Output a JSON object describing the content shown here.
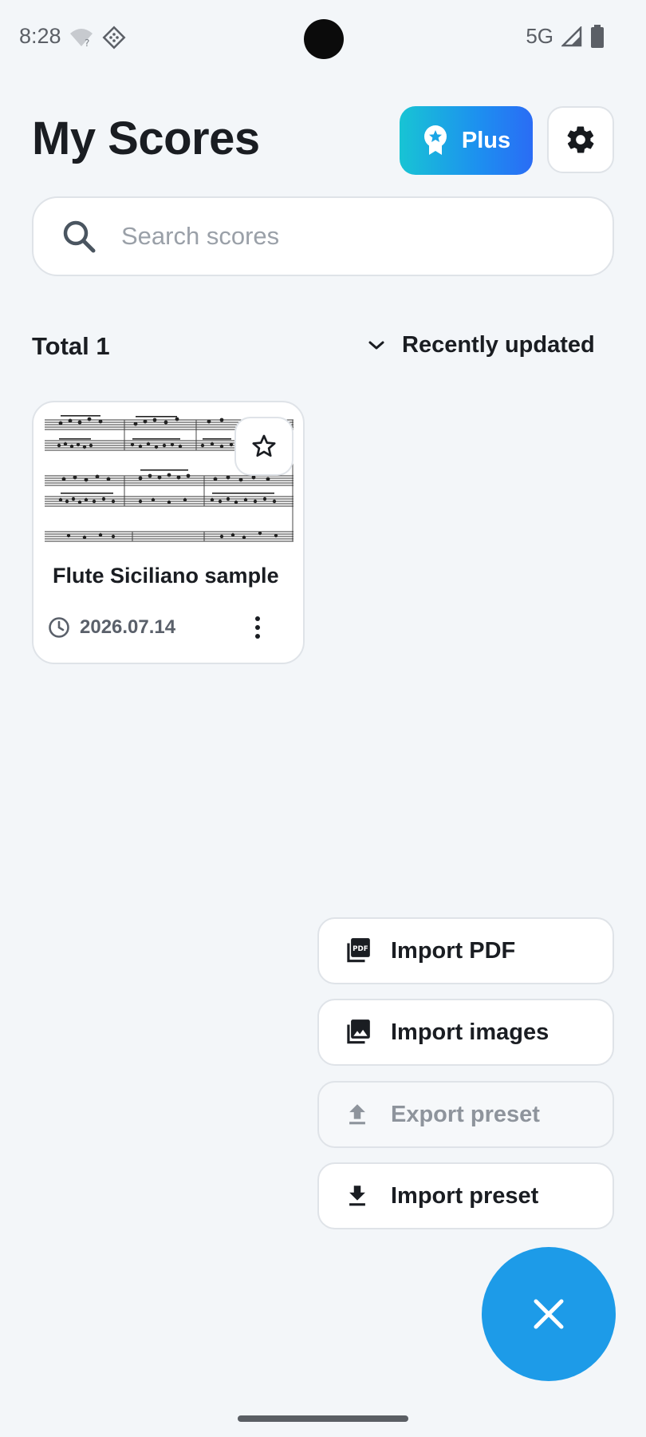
{
  "status_bar": {
    "time": "8:28",
    "network": "5G"
  },
  "header": {
    "title": "My Scores",
    "plus_label": "Plus"
  },
  "search": {
    "placeholder": "Search scores",
    "value": ""
  },
  "list": {
    "total_label": "Total 1",
    "sort_label": "Recently updated"
  },
  "scores": [
    {
      "title": "Flute Siciliano sample",
      "date": "2026.07.14",
      "favorite": false
    }
  ],
  "menu": {
    "import_pdf": "Import PDF",
    "import_images": "Import images",
    "export_preset": "Export preset",
    "import_preset": "Import preset"
  },
  "colors": {
    "accent": "#1d9be8",
    "plus_gradient_start": "#18c4d4",
    "plus_gradient_end": "#2a6cf5"
  }
}
